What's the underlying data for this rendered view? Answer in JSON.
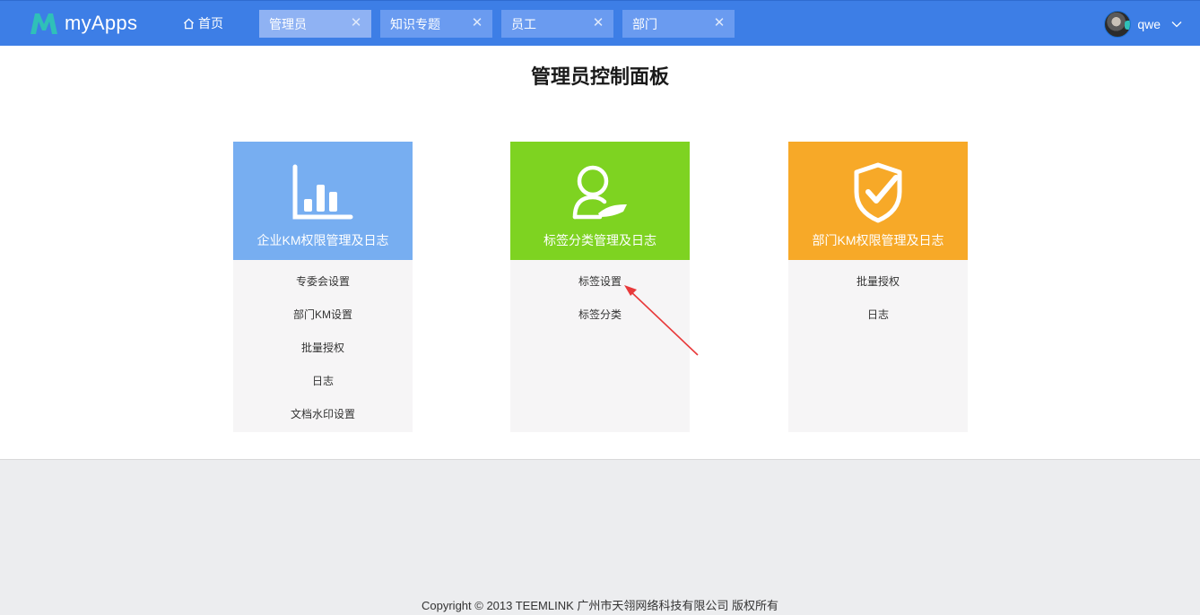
{
  "app": {
    "name": "myApps",
    "brand_color": "#3d7ee6",
    "logo_color": "#2fc0b8"
  },
  "nav": {
    "home_label": "首页",
    "tabs": [
      {
        "label": "管理员",
        "active": true
      },
      {
        "label": "知识专题",
        "active": false
      },
      {
        "label": "员工",
        "active": false
      },
      {
        "label": "部门",
        "active": false
      }
    ],
    "close_glyph": "✕"
  },
  "user": {
    "name": "qwe"
  },
  "page": {
    "title": "管理员控制面板"
  },
  "cards": [
    {
      "title": "企业KM权限管理及日志",
      "color": "#77aef1",
      "icon": "bar-chart-icon",
      "links": [
        "专委会设置",
        "部门KM设置",
        "批量授权",
        "日志",
        "文档水印设置"
      ]
    },
    {
      "title": "标签分类管理及日志",
      "color": "#7ed321",
      "icon": "user-hand-icon",
      "links": [
        "标签设置",
        "标签分类"
      ]
    },
    {
      "title": "部门KM权限管理及日志",
      "color": "#f7a928",
      "icon": "shield-check-icon",
      "links": [
        "批量授权",
        "日志"
      ]
    }
  ],
  "annotation": {
    "color": "#e8393a"
  },
  "footer": {
    "copyright": "Copyright © 2013 TEEMLINK 广州市天翎网络科技有限公司 版权所有"
  }
}
